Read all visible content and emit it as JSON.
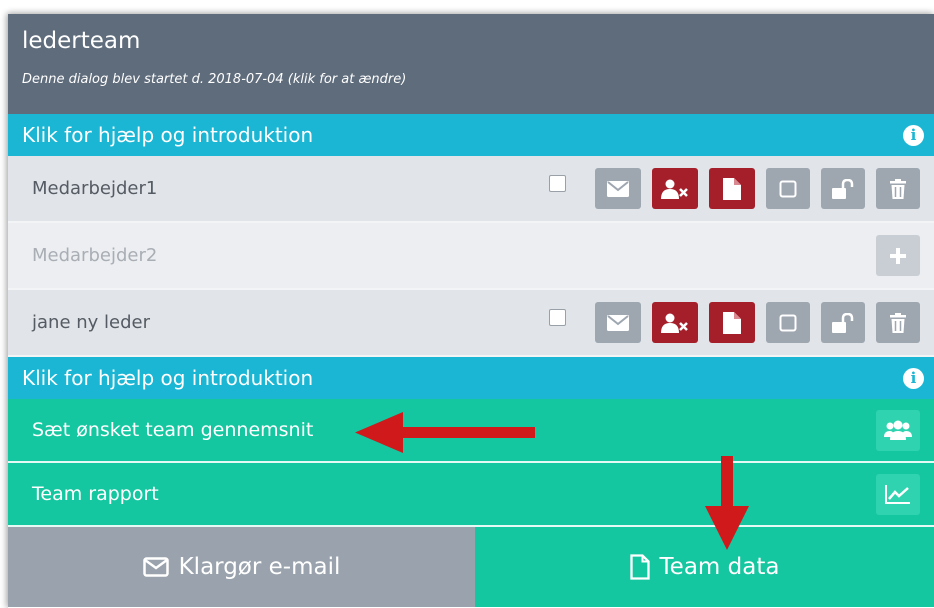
{
  "header": {
    "title": "lederteam",
    "subtitle": "Denne dialog blev startet d. 2018-07-04 (klik for at ændre)"
  },
  "help": {
    "label": "Klik for hjælp og introduktion",
    "icon": "info-icon"
  },
  "members": [
    {
      "name": "Medarbejder1",
      "active": true
    },
    {
      "name": "Medarbejder2",
      "active": false
    },
    {
      "name": "jane ny leder",
      "active": true
    }
  ],
  "team": {
    "set_average_label": "Sæt ønsket team gennemsnit",
    "set_average_icon": "users-icon",
    "report_label": "Team rapport",
    "report_icon": "line-chart-icon"
  },
  "footer": {
    "email_label": "Klargør e-mail",
    "data_label": "Team data"
  },
  "colors": {
    "header": "#5f6c7c",
    "help_bar": "#1ab6d4",
    "row": "#e1e4e9",
    "action_gray": "#9ea6b0",
    "action_red": "#a51f2b",
    "team_green": "#15c7a0",
    "annotation_arrow": "#d0191b"
  }
}
